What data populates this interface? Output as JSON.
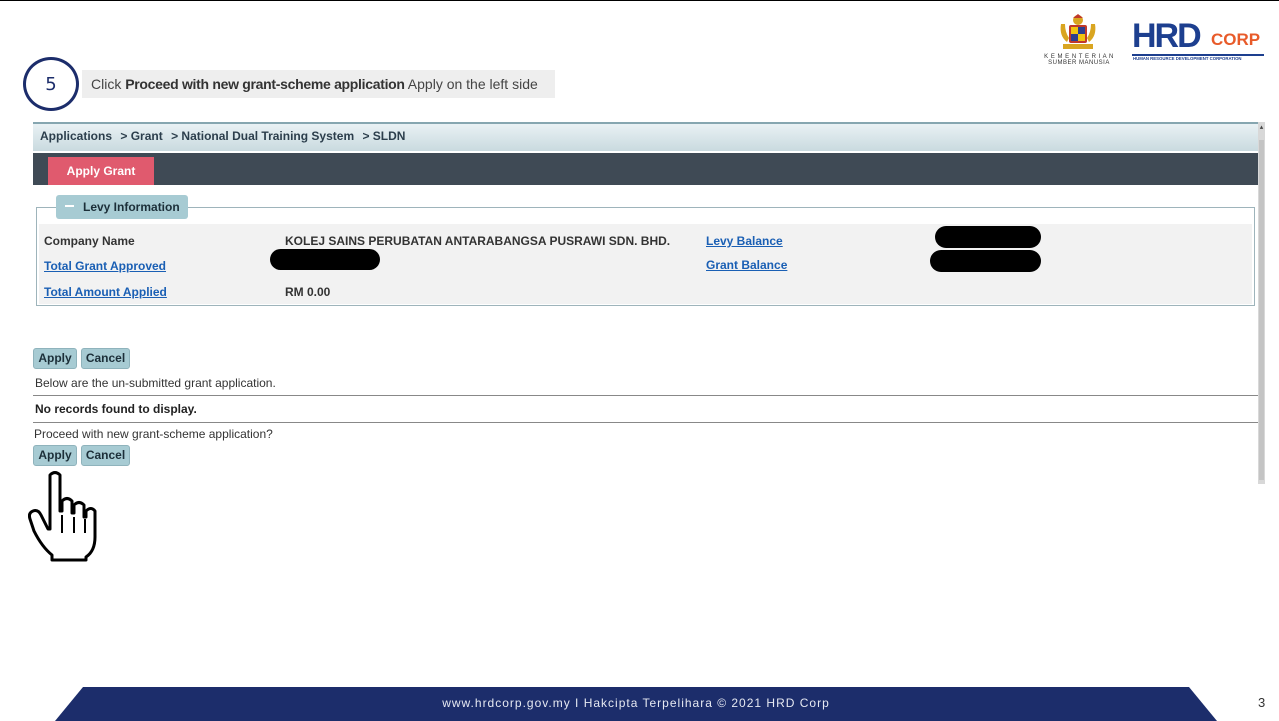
{
  "logos": {
    "ministry_text_line1": "K E M E N T E R I A N",
    "ministry_text_line2": "SUMBER MANUSIA",
    "hrd_word": "HRD",
    "corp_word": "CORP",
    "hrd_subtitle": "HUMAN RESOURCE DEVELOPMENT CORPORATION"
  },
  "step": {
    "number": "5",
    "prefix": "Click",
    "bold": "Proceed with new grant-scheme application",
    "suffix": "Apply on the left side"
  },
  "breadcrumb": [
    "Applications",
    "> Grant",
    "> National Dual Training System",
    "> SLDN"
  ],
  "tabs": {
    "apply_grant": "Apply Grant"
  },
  "levy": {
    "legend": "Levy Information",
    "company_name_label": "Company Name",
    "company_name_value": "KOLEJ SAINS PERUBATAN ANTARABANGSA PUSRAWI SDN. BHD.",
    "total_grant_approved_label": "Total Grant Approved",
    "total_amount_applied_label": "Total Amount Applied",
    "total_amount_applied_value": "RM 0.00",
    "levy_balance_label": "Levy Balance",
    "grant_balance_label": "Grant Balance"
  },
  "actions": {
    "apply": "Apply",
    "cancel": "Cancel",
    "unsubmitted_note": "Below are the un-submitted grant application.",
    "no_records": "No records found to display.",
    "proceed_question": "Proceed with new grant-scheme application?"
  },
  "footer": {
    "text": "www.hrdcorp.gov.my  I  Hakcipta Terpelihara © 2021 HRD Corp",
    "page_number": "3"
  },
  "colors": {
    "navy": "#1c2d6b",
    "tab_red": "#e05a6e",
    "button_teal": "#a7cbd3",
    "link_blue": "#1a5fb4",
    "hrd_orange": "#e85b2a"
  }
}
